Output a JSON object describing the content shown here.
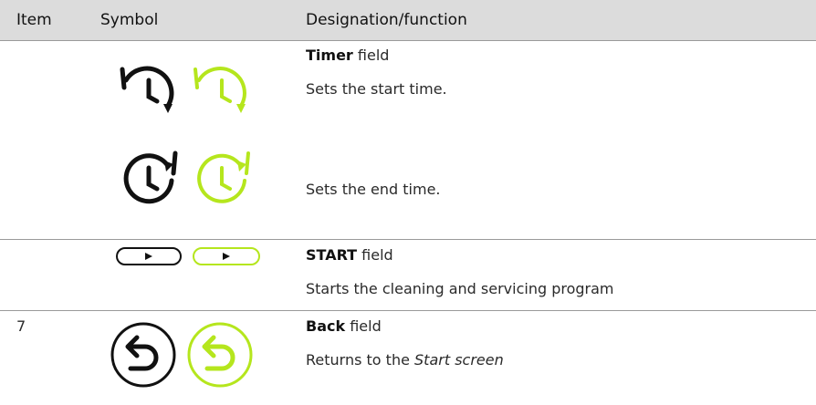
{
  "header": {
    "item": "Item",
    "symbol": "Symbol",
    "designation": "Designation/function"
  },
  "rows": [
    {
      "item": "",
      "title_bold": "Timer",
      "title_rest": " field",
      "lines": [
        "Sets the start time.",
        "Sets the end time."
      ],
      "icons": [
        "timer-start-icon",
        "timer-end-icon"
      ]
    },
    {
      "item": "",
      "title_bold": "START",
      "title_rest": " field",
      "lines": [
        "Starts the cleaning and servicing program"
      ],
      "icons": [
        "play-button-icon"
      ]
    },
    {
      "item": "7",
      "title_bold": "Back",
      "title_rest": " field",
      "line_prefix": "Returns to the ",
      "line_italic": "Start screen",
      "icons": [
        "back-arrow-icon"
      ]
    }
  ],
  "colors": {
    "header_bg": "#dcdcdc",
    "icon_inactive": "#111111",
    "icon_active": "#b5e61d",
    "divider": "#9a9a9a"
  }
}
